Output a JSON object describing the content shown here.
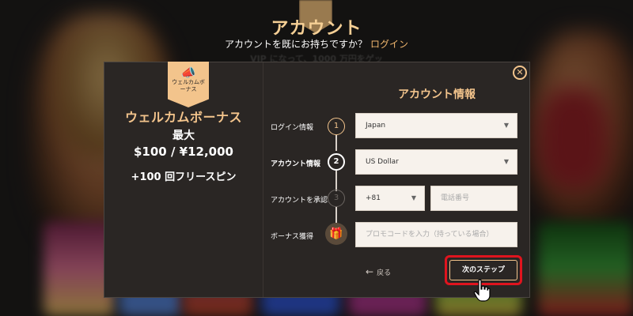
{
  "page": {
    "title": "アカウント",
    "subtitle": "アカウントを既にお持ちですか？",
    "login_link": "ログイン",
    "ghost_text": "VIP になって、1000 万円をゲッ"
  },
  "promo": {
    "badge_icon": "megaphone-icon",
    "badge_label": "ウェルカムボーナス",
    "title": "ウェルカムボーナス",
    "max": "最大",
    "amount": "$100 / ¥12,000",
    "spins": "+100 回フリースピン"
  },
  "form": {
    "title": "アカウント情報",
    "close_icon": "close-icon",
    "steps": [
      {
        "label": "ログイン情報",
        "number": "1",
        "state": "done"
      },
      {
        "label": "アカウント情報",
        "number": "2",
        "state": "active"
      },
      {
        "label": "アカウントを承認",
        "number": "3",
        "state": "pending"
      },
      {
        "label": "ボーナス獲得",
        "icon": "gift-icon",
        "state": "pending"
      }
    ],
    "country": {
      "value": "Japan"
    },
    "currency": {
      "value": "US Dollar"
    },
    "phone_code": {
      "value": "+81"
    },
    "phone_number": {
      "placeholder": "電話番号"
    },
    "promo_code": {
      "placeholder": "プロモコードを入力（持っている場合）"
    },
    "back_label": "戻る",
    "next_label": "次のステップ"
  },
  "colors": {
    "accent": "#f3c48c",
    "modal_bg": "#2a2624",
    "highlight": "#e0141e"
  }
}
